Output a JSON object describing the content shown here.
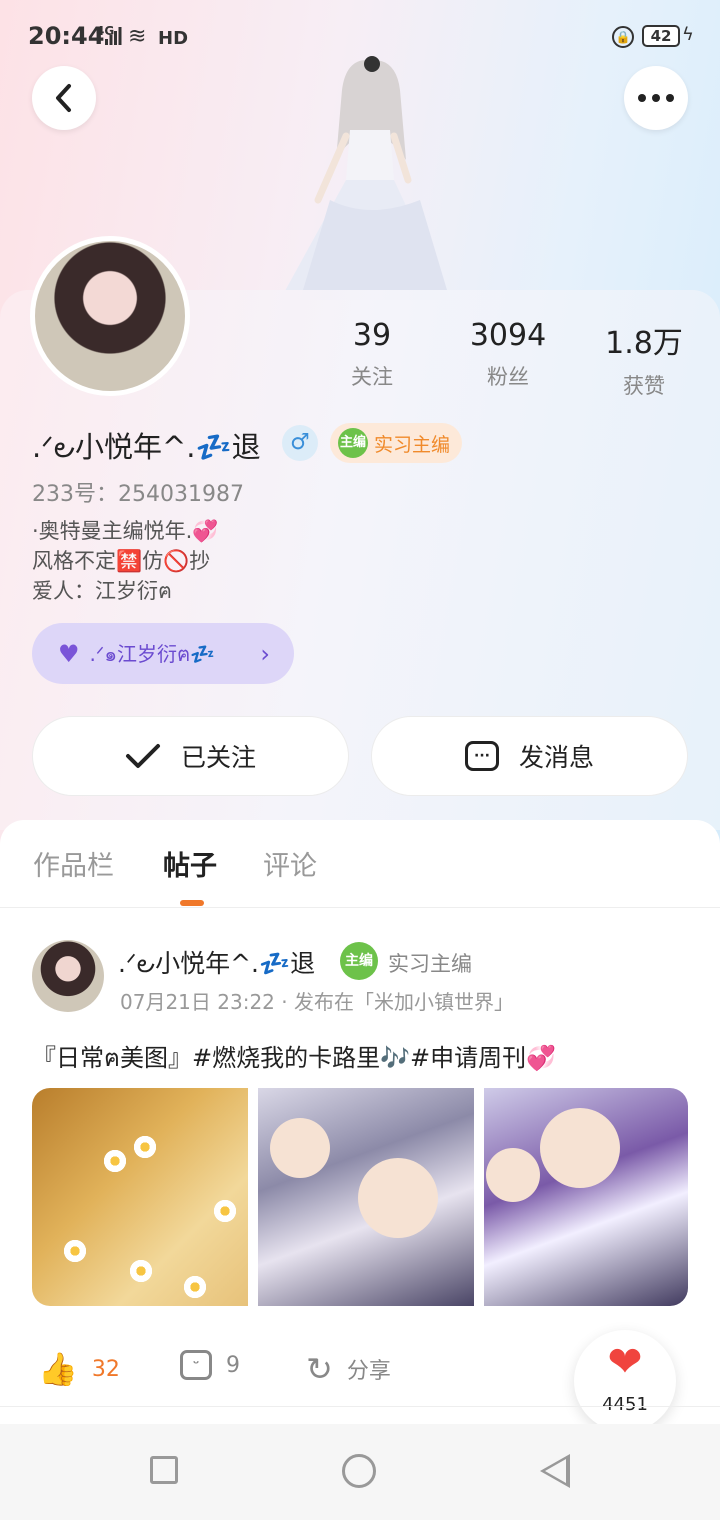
{
  "status_bar": {
    "time": "20:44",
    "network": "4G",
    "hd": "HD",
    "battery": "42"
  },
  "profile": {
    "stats": [
      {
        "value": "39",
        "label": "关注"
      },
      {
        "value": "3094",
        "label": "粉丝"
      },
      {
        "value": "1.8万",
        "label": "获赞"
      }
    ],
    "username": ".ᐟ౿小悦年^.💤退",
    "gender_symbol": "♂",
    "title_badge": "实习主编",
    "badge_icon_text": "主编",
    "uid": "233号：254031987",
    "bio_lines": [
      "·奥特曼主编悦年.💞",
      "风格不定🈲仿🚫抄",
      "爱人：江岁衍ฅ"
    ],
    "couple_name": ".ᐟ๑江岁衍ฅ💤",
    "follow_button": "已关注",
    "message_button": "发消息"
  },
  "tabs": [
    {
      "label": "作品栏",
      "active": false
    },
    {
      "label": "帖子",
      "active": true
    },
    {
      "label": "评论",
      "active": false
    }
  ],
  "post": {
    "author": ".ᐟ౿小悦年^.💤退",
    "badge_text": "实习主编",
    "badge_icon_text": "主编",
    "meta": "07月21日 23:22 · 发布在「米加小镇世界」",
    "text": "『日常ฅ美图』#燃烧我的卡路里🎶#申请周刊💞",
    "float_like_count": "4451",
    "likes": "32",
    "comments": "9",
    "share_label": "分享"
  },
  "colors": {
    "accent": "#f0782a",
    "heart": "#f0443e",
    "couple_bg": "#ddd6f8",
    "badge_bg": "#fde9d9"
  }
}
